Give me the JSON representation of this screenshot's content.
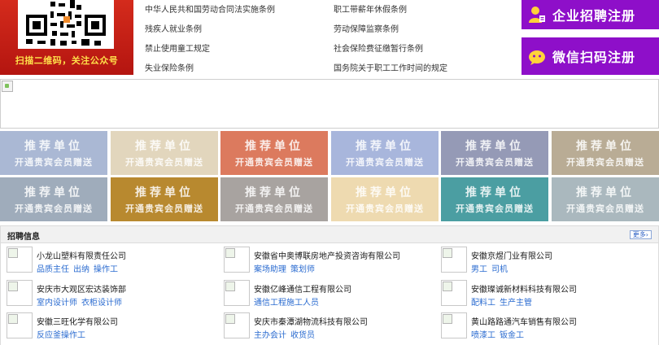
{
  "qr": {
    "caption": "扫描二维码，关注公众号"
  },
  "laws": [
    "中华人民共和国劳动合同法实施条例",
    "职工带薪年休假条例",
    "残疾人就业条例",
    "劳动保障监察条例",
    "禁止使用童工规定",
    "社会保险费征缴暂行条例",
    "失业保险条例",
    "国务院关于职工工作时间的规定"
  ],
  "register": {
    "enterprise_label": "企业招聘注册",
    "wechat_label": "微信扫码注册",
    "color": "#8e0fc9"
  },
  "tiles": [
    {
      "line1": "推荐单位",
      "line2": "开通贵宾会员赠送",
      "color": "#aab8d4"
    },
    {
      "line1": "推荐单位",
      "line2": "开通贵宾会员赠送",
      "color": "#e2d6bd"
    },
    {
      "line1": "推荐单位",
      "line2": "开通贵宾会员赠送",
      "color": "#dc7a5e"
    },
    {
      "line1": "推荐单位",
      "line2": "开通贵宾会员赠送",
      "color": "#a8b6dc"
    },
    {
      "line1": "推荐单位",
      "line2": "开通贵宾会员赠送",
      "color": "#959ab6"
    },
    {
      "line1": "推荐单位",
      "line2": "开通贵宾会员赠送",
      "color": "#b9ac95"
    },
    {
      "line1": "推荐单位",
      "line2": "开通贵宾会员赠送",
      "color": "#9facbb"
    },
    {
      "line1": "推荐单位",
      "line2": "开通贵宾会员赠送",
      "color": "#b8892f"
    },
    {
      "line1": "推荐单位",
      "line2": "开通贵宾会员赠送",
      "color": "#a8a3a0"
    },
    {
      "line1": "推荐单位",
      "line2": "开通贵宾会员赠送",
      "color": "#eedab0"
    },
    {
      "line1": "推荐单位",
      "line2": "开通贵宾会员赠送",
      "color": "#4b9ea2"
    },
    {
      "line1": "推荐单位",
      "line2": "开通贵宾会员赠送",
      "color": "#aab8be"
    }
  ],
  "recruit": {
    "title": "招聘信息",
    "more_label": "更多›",
    "companies": [
      {
        "name": "小龙山塑料有限责任公司",
        "jobs": [
          "品质主任",
          "出纳",
          "操作工"
        ]
      },
      {
        "name": "安徽省中奥博联房地产投资咨询有限公司",
        "jobs": [
          "案场助理",
          "策划师"
        ]
      },
      {
        "name": "安徽京煜门业有限公司",
        "jobs": [
          "男工",
          "司机"
        ]
      },
      {
        "name": "安庆市大观区宏达装饰部",
        "jobs": [
          "室内设计师",
          "衣柜设计师"
        ]
      },
      {
        "name": "安徽亿峰通信工程有限公司",
        "jobs": [
          "通信工程施工人员"
        ]
      },
      {
        "name": "安徽璨诚新材料科技有限公司",
        "jobs": [
          "配料工",
          "生产主管"
        ]
      },
      {
        "name": "安徽三旺化学有限公司",
        "jobs": [
          "反应釜操作工"
        ]
      },
      {
        "name": "安庆市秦潭湖物流科技有限公司",
        "jobs": [
          "主办会计",
          "收货员"
        ]
      },
      {
        "name": "黄山路路通汽车销售有限公司",
        "jobs": [
          "喷漆工",
          "钣金工"
        ]
      }
    ]
  }
}
